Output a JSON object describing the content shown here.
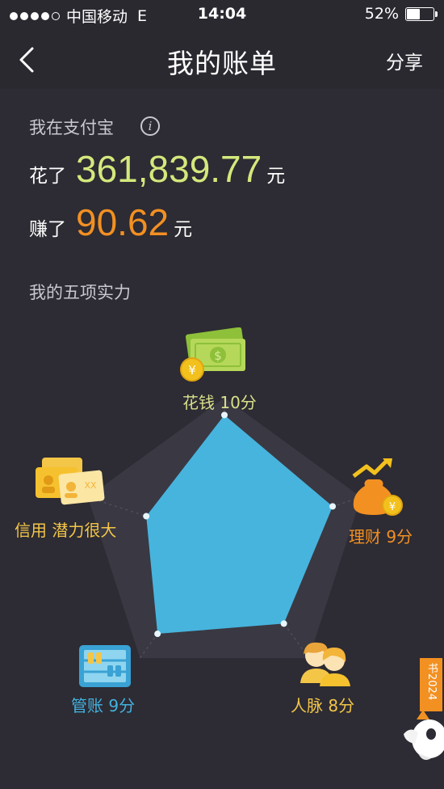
{
  "status_bar": {
    "carrier": "中国移动",
    "network": "E",
    "time": "14:04",
    "battery": "52%",
    "battery_level": 0.52,
    "signal_bars": 4
  },
  "nav": {
    "back_icon": "chevron-left-icon",
    "title": "我的账单",
    "share": "分享"
  },
  "summary": {
    "title": "我在支付宝",
    "info_icon": "info-icon",
    "spent_label": "花了",
    "spent_amount": "361,839.77",
    "spent_unit": "元",
    "earned_label": "赚了",
    "earned_amount": "90.62",
    "earned_unit": "元"
  },
  "abilities": {
    "title": "我的五项实力",
    "items": [
      {
        "name": "花钱",
        "score_text": "10分",
        "caption": "花钱 10分",
        "icon": "money-icon",
        "value": 10,
        "color": "#d8e08a"
      },
      {
        "name": "理财",
        "score_text": "9分",
        "caption": "理财 9分",
        "icon": "money-bag-icon",
        "value": 9,
        "color": "#f29022"
      },
      {
        "name": "人脉",
        "score_text": "8分",
        "caption": "人脉 8分",
        "icon": "people-icon",
        "value": 8,
        "color": "#f3c648"
      },
      {
        "name": "管账",
        "score_text": "9分",
        "caption": "管账 9分",
        "icon": "abacus-icon",
        "value": 9,
        "color": "#43b2e0"
      },
      {
        "name": "信用",
        "score_text": "潜力很大",
        "caption": "信用 潜力很大",
        "icon": "credit-card-icon",
        "value": 6.5,
        "color": "#f3c648"
      }
    ],
    "max": 10,
    "fill_color": "#47b4de"
  },
  "decoration": {
    "ribbon_text": "书2024",
    "ribbon_icon": "rocket-icon"
  }
}
